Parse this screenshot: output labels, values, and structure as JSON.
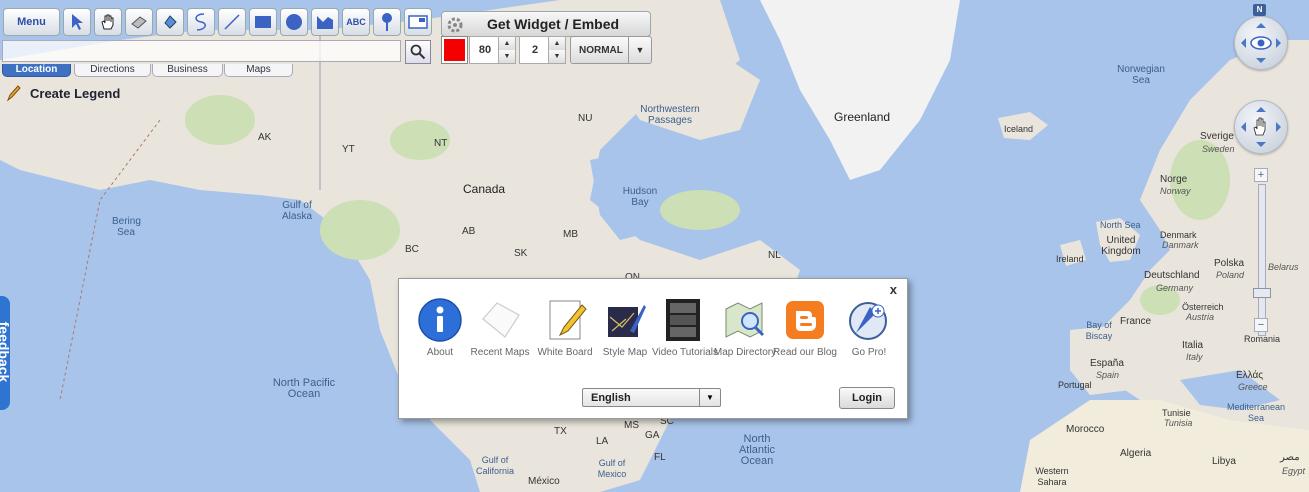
{
  "toolbar": {
    "menu_label": "Menu",
    "tools": [
      "select-arrow",
      "hand-pan",
      "eraser",
      "fill-bucket",
      "freehand-curve",
      "line",
      "rectangle",
      "circle",
      "polygon",
      "text",
      "marker",
      "image-overlay"
    ],
    "text_tool_label": "ABC",
    "widget_label": "Get Widget / Embed",
    "color": "#f40000",
    "opacity_value": "80",
    "line_width_value": "2",
    "mode_value": "NORMAL"
  },
  "tabs": [
    {
      "label": "Location",
      "active": true
    },
    {
      "label": "Directions",
      "active": false
    },
    {
      "label": "Business",
      "active": false
    },
    {
      "label": "Maps",
      "active": false
    }
  ],
  "legend_label": "Create Legend",
  "feedback_label": "feedback",
  "nav": {
    "north_label": "N"
  },
  "map_labels": {
    "greenland": "Greenland",
    "canada": "Canada",
    "nu": "NU",
    "nw_passages": "Northwestern Passages",
    "ak": "AK",
    "yt": "YT",
    "nt": "NT",
    "hudson_bay": "Hudson Bay",
    "gulf_alaska": "Gulf of Alaska",
    "bering_sea": "Bering Sea",
    "ab": "AB",
    "mb": "MB",
    "bc": "BC",
    "sk": "SK",
    "nl": "NL",
    "on": "ON",
    "norwegian_sea": "Norwegian Sea",
    "iceland": "Iceland",
    "sverige": "Sverige",
    "sweden": "Sweden",
    "norge": "Norge",
    "norway": "Norway",
    "north_sea": "North Sea",
    "uk": "United Kingdom",
    "denmark": "Denmark",
    "danmark": "Danmark",
    "ireland": "Ireland",
    "deutschland": "Deutschland",
    "germany": "Germany",
    "polska": "Polska",
    "poland": "Poland",
    "belarus": "Belarus",
    "france": "France",
    "bay_biscay": "Bay of Biscay",
    "osterreich": "Österreich",
    "austria": "Austria",
    "italia": "Italia",
    "italy": "Italy",
    "romania": "Romania",
    "espana": "España",
    "spain": "Spain",
    "portugal": "Portugal",
    "ellas": "Ελλάς",
    "greece": "Greece",
    "tunisie": "Tunisie",
    "tunisia": "Tunisia",
    "med_sea": "Mediterranean Sea",
    "morocco": "Morocco",
    "algeria": "Algeria",
    "libya": "Libya",
    "misr": "مصر",
    "egypt": "Egypt",
    "western_sahara": "Western Sahara",
    "north_pacific": "North Pacific Ocean",
    "north_atlantic": "North Atlantic Ocean",
    "gulf_california": "Gulf of California",
    "gulf_mexico": "Gulf of Mexico",
    "tx": "TX",
    "la": "LA",
    "ms": "MS",
    "ga": "GA",
    "sc": "SC",
    "fl": "FL",
    "mexico": "México"
  },
  "dialog": {
    "close_label": "x",
    "items": [
      {
        "label": "About",
        "icon": "info-icon"
      },
      {
        "label": "Recent Maps",
        "icon": "recent-maps-icon"
      },
      {
        "label": "White Board",
        "icon": "whiteboard-icon"
      },
      {
        "label": "Style Map",
        "icon": "style-map-icon"
      },
      {
        "label": "Video Tutorials",
        "icon": "film-icon"
      },
      {
        "label": "Map Directory",
        "icon": "map-directory-icon"
      },
      {
        "label": "Read our Blog",
        "icon": "blogger-icon"
      },
      {
        "label": "Go Pro!",
        "icon": "go-pro-icon"
      }
    ],
    "language": "English",
    "login_label": "Login"
  }
}
